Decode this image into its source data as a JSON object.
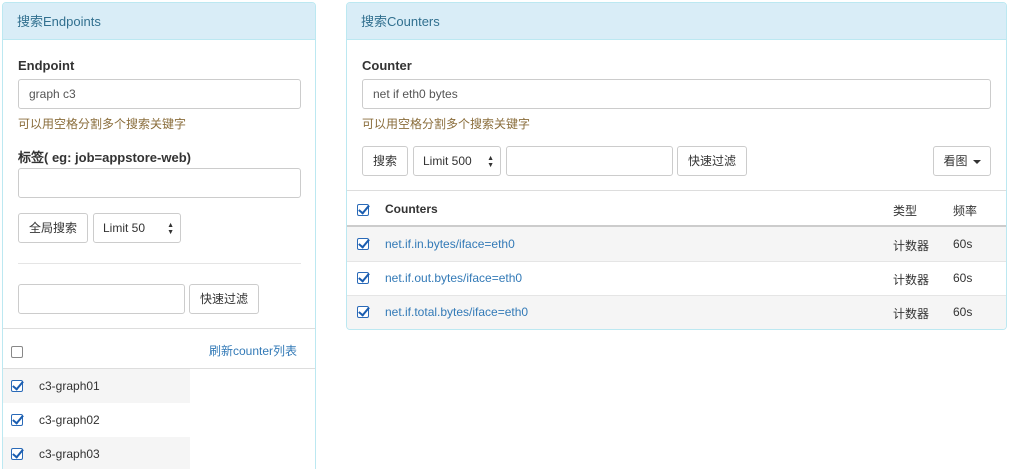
{
  "left": {
    "title": "搜索Endpoints",
    "endpoint_label": "Endpoint",
    "endpoint_value": "graph c3",
    "endpoint_help": "可以用空格分割多个搜索关键字",
    "tag_label": "标签( eg: job=appstore-web)",
    "tag_value": "",
    "global_search_label": "全局搜索",
    "limit_selected": "Limit 50",
    "filter_value": "",
    "quick_filter_label": "快速过滤",
    "refresh_label": "刷新counter列表",
    "select_all_checked": false,
    "endpoints": [
      {
        "name": "c3-graph01",
        "checked": true
      },
      {
        "name": "c3-graph02",
        "checked": true
      },
      {
        "name": "c3-graph03",
        "checked": true
      }
    ]
  },
  "right": {
    "title": "搜索Counters",
    "counter_label": "Counter",
    "counter_value": "net if eth0 bytes",
    "counter_help": "可以用空格分割多个搜索关键字",
    "search_label": "搜索",
    "limit_selected": "Limit 500",
    "filter_value": "",
    "quick_filter_label": "快速过滤",
    "view_label": "看图",
    "table": {
      "select_all_checked": true,
      "headers": {
        "counter": "Counters",
        "type": "类型",
        "step": "频率"
      },
      "rows": [
        {
          "counter": "net.if.in.bytes/iface=eth0",
          "type": "计数器",
          "step": "60s",
          "checked": true
        },
        {
          "counter": "net.if.out.bytes/iface=eth0",
          "type": "计数器",
          "step": "60s",
          "checked": true
        },
        {
          "counter": "net.if.total.bytes/iface=eth0",
          "type": "计数器",
          "step": "60s",
          "checked": true
        }
      ]
    }
  }
}
